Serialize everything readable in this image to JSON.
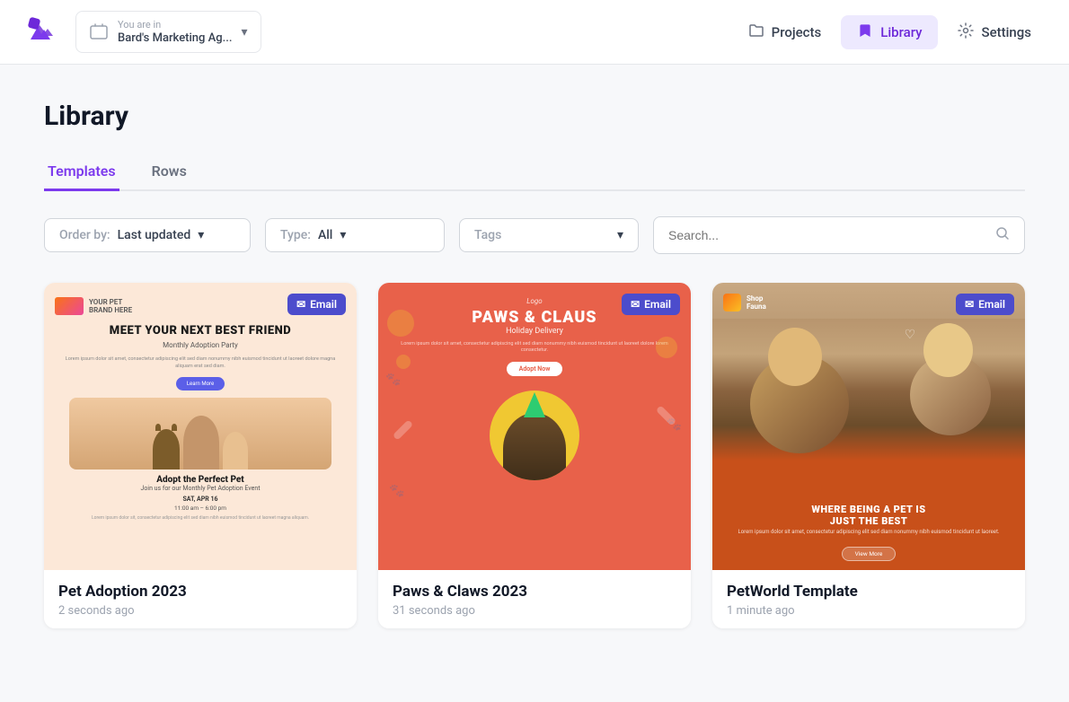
{
  "app": {
    "logo_alt": "App Logo"
  },
  "navbar": {
    "workspace_label": "You are in",
    "workspace_name": "Bard's Marketing Ag...",
    "nav_items": [
      {
        "id": "projects",
        "label": "Projects",
        "icon": "folder-icon",
        "active": false
      },
      {
        "id": "library",
        "label": "Library",
        "icon": "bookmark-icon",
        "active": true
      },
      {
        "id": "settings",
        "label": "Settings",
        "icon": "gear-icon",
        "active": false
      }
    ]
  },
  "page": {
    "title": "Library"
  },
  "tabs": [
    {
      "id": "templates",
      "label": "Templates",
      "active": true
    },
    {
      "id": "rows",
      "label": "Rows",
      "active": false
    }
  ],
  "filters": {
    "order_by": {
      "label": "Order by:",
      "value": "Last updated",
      "chevron": "▾"
    },
    "type": {
      "label": "Type:",
      "value": "All",
      "chevron": "▾"
    },
    "tags": {
      "placeholder": "Tags",
      "chevron": "▾"
    },
    "search": {
      "placeholder": "Search..."
    }
  },
  "templates": [
    {
      "id": "pet-adoption",
      "badge": "Email",
      "title": "Pet Adoption 2023",
      "timestamp": "2 seconds ago"
    },
    {
      "id": "paws-claws",
      "badge": "Email",
      "title": "Paws & Claws 2023",
      "timestamp": "31 seconds ago"
    },
    {
      "id": "petworld",
      "badge": "Email",
      "title": "PetWorld Template",
      "timestamp": "1 minute ago"
    }
  ]
}
